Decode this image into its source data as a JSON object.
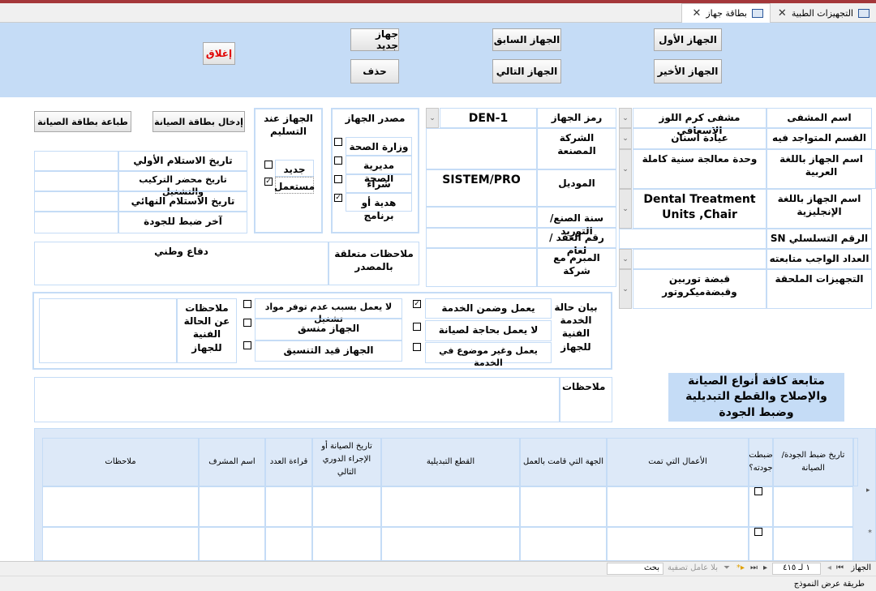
{
  "tabs": [
    {
      "label": "التجهيزات الطبية",
      "active": false
    },
    {
      "label": "بطاقة جهاز",
      "active": true
    }
  ],
  "toolbar": {
    "first": "الجهاز الأول",
    "last": "الجهاز الأخير",
    "prev": "الجهاز السابق",
    "next": "الجهاز التالي",
    "new": "جهاز جديد",
    "delete": "حذف",
    "close": "إغلاق"
  },
  "device_info": [
    {
      "label": "اسم المشفى",
      "value": "مشفى كرم اللوز الاسعافي",
      "dropdown": true
    },
    {
      "label": "القسم المتواجد فيه",
      "value": "عيادة أسنان",
      "dropdown": true
    },
    {
      "label": "اسم الجهاز باللغة العربية",
      "value": "وحدة معالجة سنية كاملة",
      "dropdown": true
    },
    {
      "label": "اسم الجهاز باللغة الإنجليزية",
      "value": "Dental Treatment Units ,Chair",
      "dropdown": true
    },
    {
      "label": "الرقم التسلسلي SN",
      "value": "",
      "dropdown": false
    },
    {
      "label": "العداد الواجب متابعته",
      "value": "",
      "dropdown": true
    },
    {
      "label": "التجهيزات الملحقة",
      "value": "قبضة توربين وقبضةميكروتور",
      "dropdown": true
    }
  ],
  "device_details": [
    {
      "label": "رمز الجهاز",
      "value": "DEN-1"
    },
    {
      "label": "الشركة المصنعة",
      "value": ""
    },
    {
      "label": "الموديل",
      "value": "SISTEM/PRO"
    },
    {
      "label": "سنة الصنع/التوريد",
      "value": ""
    },
    {
      "label": "رقم العقد / لعام",
      "value": ""
    },
    {
      "label": "المبرم مع شركة",
      "value": ""
    }
  ],
  "source": {
    "title": "مصدر الجهاز",
    "options": [
      {
        "label": "وزارة الصحة",
        "checked": false
      },
      {
        "label": "مديرية الصحة",
        "checked": false
      },
      {
        "label": "شراء",
        "checked": false
      },
      {
        "label": "هدية أو برنامج",
        "checked": true
      }
    ]
  },
  "delivery": {
    "title": "الجهاز عند التسليم",
    "options": [
      {
        "label": "جديد",
        "checked": false
      },
      {
        "label": "مستعمل",
        "checked": true
      }
    ]
  },
  "actions": {
    "print": "طباعة بطاقة الصيانة",
    "enter": "إدخال بطاقة الصيانة"
  },
  "dates": [
    {
      "label": "تاريخ الاستلام الأولي",
      "value": ""
    },
    {
      "label": "تاريخ محضر التركيب والتشغيل",
      "value": ""
    },
    {
      "label": "تاريخ الاستلام النهائي",
      "value": ""
    },
    {
      "label": "آخر ضبط للجودة",
      "value": ""
    }
  ],
  "source_notes": {
    "label": "ملاحظات متعلقة بالمصدر",
    "value": "دفاع وطني"
  },
  "status": {
    "title": "بيان حالة الخدمة الفنية للجهاز",
    "col1": [
      {
        "label": "يعمل وضمن الخدمة",
        "checked": true
      },
      {
        "label": "لا يعمل بحاجة لصيانة",
        "checked": false
      },
      {
        "label": "يعمل وغير موضوع في الخدمة",
        "checked": false
      }
    ],
    "col2": [
      {
        "label": "لا يعمل بسبب عدم توفر مواد تشغيل",
        "checked": false
      },
      {
        "label": "الجهاز منسق",
        "checked": false
      },
      {
        "label": "الجهاز قيد التنسيق",
        "checked": false
      }
    ],
    "notes_label": "ملاحظات عن الحالة الفنية للجهاز",
    "notes_value": ""
  },
  "notes": {
    "label": "ملاحظات",
    "value": ""
  },
  "section_title": "متابعة كافة أنواع الصيانة والإصلاح والقطع التبديلية وضبط الجودة",
  "grid": {
    "columns": [
      "تاريخ ضبط الجودة/الصيانة",
      "ضبطت جودته؟",
      "الأعمال التي تمت",
      "الجهة التي قامت بالعمل",
      "القطع التبديلية",
      "تاريخ الصيانة أو الإجراء الدوري التالي",
      "قراءة العدد",
      "اسم المشرف",
      "ملاحظات"
    ],
    "rows": [
      {
        "checked": false
      },
      {
        "checked": false
      }
    ]
  },
  "nav": {
    "record_label": "الجهاز",
    "position": "١ لـ ٤١٥",
    "filter": "بلا عامل تصفية",
    "search_placeholder": "بحث"
  },
  "statusbar": "طريقة عرض النموذج"
}
